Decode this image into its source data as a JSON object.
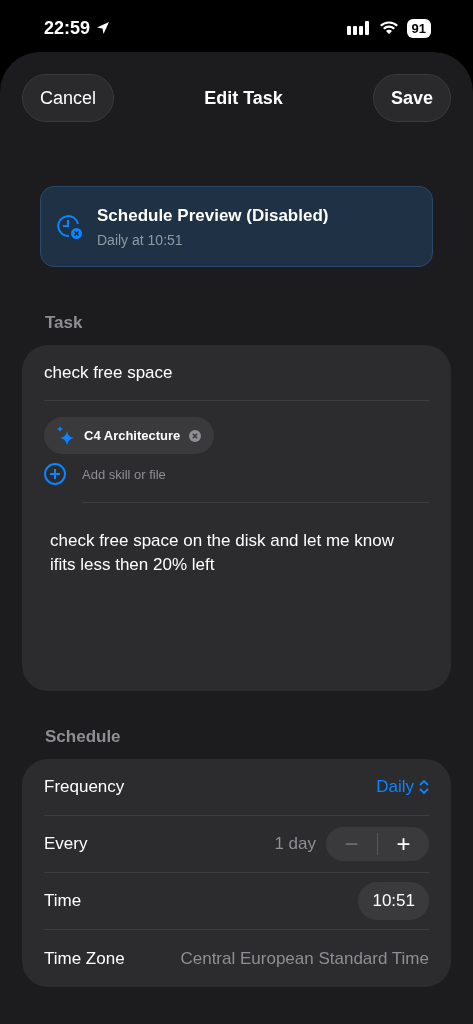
{
  "status_bar": {
    "time": "22:59",
    "battery": "91"
  },
  "nav": {
    "cancel": "Cancel",
    "title": "Edit Task",
    "save": "Save"
  },
  "preview": {
    "title": "Schedule Preview (Disabled)",
    "subtitle": "Daily at 10:51"
  },
  "task": {
    "label": "Task",
    "name": "check free space",
    "chips": [
      {
        "label": "C4 Architecture"
      }
    ],
    "add_label": "Add skill or file",
    "prompt": "check free space on the disk and let me know ifits less then 20% left"
  },
  "schedule": {
    "label": "Schedule",
    "rows": [
      {
        "kind": "picker",
        "label": "Frequency",
        "value": "Daily"
      },
      {
        "kind": "stepper",
        "label": "Every",
        "value": "1 day",
        "decrement_disabled": true,
        "decrement": "−",
        "increment": "+"
      },
      {
        "kind": "time",
        "label": "Time",
        "value": "10:51"
      },
      {
        "kind": "text",
        "label": "Time Zone",
        "value": "Central European Standard Time"
      }
    ]
  }
}
